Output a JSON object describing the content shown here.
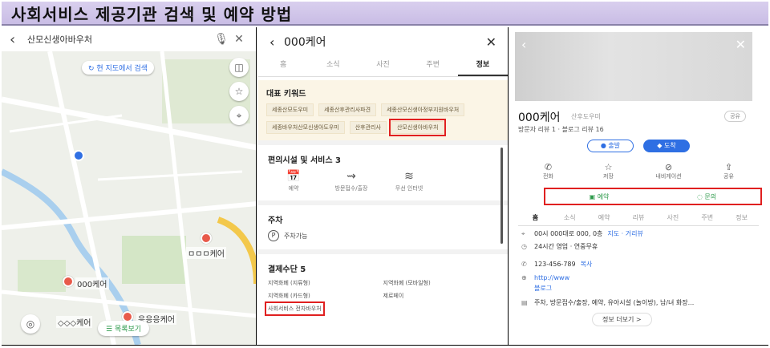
{
  "title": "사회서비스 제공기관 검색 및 예약 방법",
  "map_panel": {
    "search_query": "산모신생아바우처",
    "current_area_button": "현 지도에서 검색",
    "list_view_button": "목록보기",
    "labels": [
      {
        "text": "ㅁㅁㅁ케어"
      },
      {
        "text": "000케어"
      },
      {
        "text": "◇◇◇케어"
      },
      {
        "text": "응응응케어"
      }
    ]
  },
  "info_panel": {
    "place_name": "000케어",
    "tabs": [
      "홈",
      "소식",
      "사진",
      "주변",
      "정보"
    ],
    "active_tab": 4,
    "keywords_title": "대표 키워드",
    "keywords": [
      "세종산모도우미",
      "세종산후관리사파견",
      "세종산모신생아정부지원바우처",
      "세종바우처산모신생아도우미",
      "산후관리사",
      "산모신생아바우처"
    ],
    "highlighted_keyword": 5,
    "facilities_title": "편의시설 및 서비스 3",
    "facilities": [
      {
        "icon": "calendar-icon",
        "label": "예약"
      },
      {
        "icon": "visit-icon",
        "label": "방문접수/출장"
      },
      {
        "icon": "wifi-icon",
        "label": "무선 인터넷"
      }
    ],
    "parking_title": "주차",
    "parking_text": "주차가능",
    "payment_title": "결제수단 5",
    "payments": [
      "지역화폐 (지류형)",
      "지역화폐 (모바일형)",
      "지역화폐 (카드형)",
      "제로페이",
      "사회서비스 전자바우처"
    ]
  },
  "detail_panel": {
    "place_name": "000케어",
    "category": "산후도우미",
    "share_label": "공유",
    "review_line": "방문자 리뷰 1 · 블로그 리뷰 16",
    "start_button": "출발",
    "arrive_button": "도착",
    "actions": [
      {
        "icon": "phone-icon",
        "label": "전화"
      },
      {
        "icon": "star-icon",
        "label": "저장"
      },
      {
        "icon": "navigation-icon",
        "label": "내비게이션"
      },
      {
        "icon": "share-icon",
        "label": "공유"
      }
    ],
    "reserve_button": "예약",
    "inquiry_button": "문의",
    "tabs": [
      "홈",
      "소식",
      "예약",
      "리뷰",
      "사진",
      "주변",
      "정보"
    ],
    "active_tab": 0,
    "address": "00시 000대로 000, 0층",
    "address_link": "지도 · 거리뷰",
    "hours": "24시간 영업 · 연중무휴",
    "phone": "123-456-789",
    "copy_label": "복사",
    "website": "http://www",
    "website_sub": "블로그",
    "amenities": "주차, 방문접수/출장, 예약, 유아시설 (놀이방), 남/녀 화장...",
    "more_button": "정보 더보기 >"
  }
}
